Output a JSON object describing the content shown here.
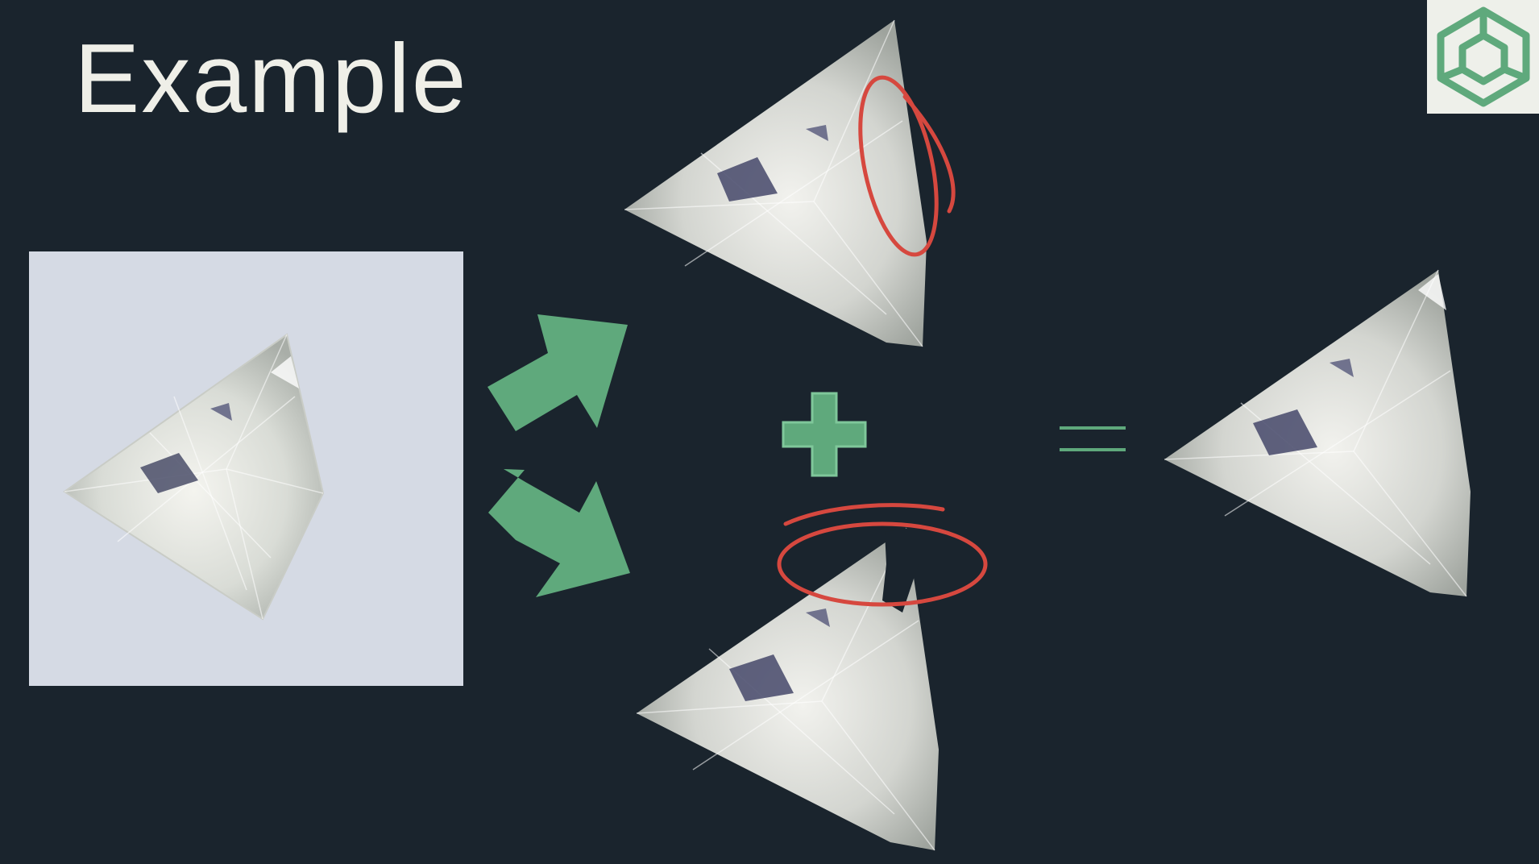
{
  "slide": {
    "title": "Example",
    "colors": {
      "background": "#1a242d",
      "accent_green": "#5fa97c",
      "highlight_red": "#d6483f",
      "logo_bg": "#eef0ea",
      "photo_bg": "#d5dae4"
    },
    "icons": {
      "logo": "cube-outline-icon",
      "arrow_up": "arrow-up-right-icon",
      "arrow_down": "arrow-down-right-icon",
      "plus": "plus-icon",
      "equals": "equals-icon"
    }
  }
}
